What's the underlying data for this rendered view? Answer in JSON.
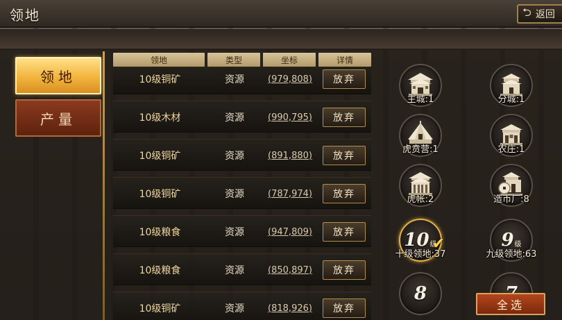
{
  "header": {
    "title": "领地",
    "back_label": "返回"
  },
  "tabs": [
    {
      "label": "领地",
      "active": true
    },
    {
      "label": "产量",
      "active": false
    }
  ],
  "table": {
    "columns": [
      "领地",
      "类型",
      "坐标",
      "详情"
    ],
    "action_label": "放弃",
    "rows": [
      {
        "name": "10级铜矿",
        "type": "资源",
        "coord": "(979,808)"
      },
      {
        "name": "10级木材",
        "type": "资源",
        "coord": "(990,795)"
      },
      {
        "name": "10级铜矿",
        "type": "资源",
        "coord": "(891,880)"
      },
      {
        "name": "10级铜矿",
        "type": "资源",
        "coord": "(787,974)"
      },
      {
        "name": "10级粮食",
        "type": "资源",
        "coord": "(947,809)"
      },
      {
        "name": "10级粮食",
        "type": "资源",
        "coord": "(850,897)"
      },
      {
        "name": "10级铜矿",
        "type": "资源",
        "coord": "(818,926)"
      }
    ]
  },
  "filters": [
    {
      "label": "主城:1",
      "icon": "main-city-icon"
    },
    {
      "label": "分城:1",
      "icon": "branch-city-icon"
    },
    {
      "label": "虎贲营:1",
      "icon": "barracks-tent-icon"
    },
    {
      "label": "农庄:1",
      "icon": "farm-icon"
    },
    {
      "label": "虎帐:2",
      "icon": "tiger-tent-icon"
    },
    {
      "label": "造币厂:8",
      "icon": "mint-icon"
    },
    {
      "label": "十级领地:37",
      "level": "10",
      "level_suffix": "级",
      "selected": true
    },
    {
      "label": "九级领地:63",
      "level": "9",
      "level_suffix": "级",
      "selected": false
    },
    {
      "level": "8"
    },
    {
      "level": "7"
    }
  ],
  "footer": {
    "select_all_label": "全选"
  },
  "colors": {
    "accent_gold": "#f2b43c",
    "button_red": "#b3451c",
    "text_gold": "#f1d79a"
  }
}
